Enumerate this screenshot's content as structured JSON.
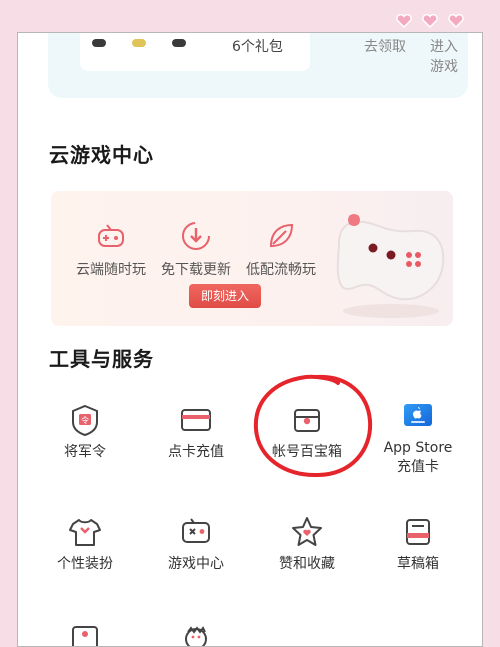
{
  "top": {
    "gift_text": "6个礼包",
    "action_left": "去领取",
    "action_right": "进入游戏"
  },
  "cloud": {
    "title": "云游戏中心",
    "features": [
      {
        "label": "云端随时玩",
        "icon": "gamepad-icon"
      },
      {
        "label": "免下载更新",
        "icon": "download-icon"
      },
      {
        "label": "低配流畅玩",
        "icon": "leaf-icon"
      }
    ],
    "join_label": "即刻进入"
  },
  "tools": {
    "title": "工具与服务",
    "items": [
      {
        "label": "将军令",
        "icon": "shield-token-icon"
      },
      {
        "label": "点卡充值",
        "icon": "card-icon"
      },
      {
        "label": "帐号百宝箱",
        "icon": "treasure-box-icon"
      },
      {
        "label": "App Store\n充值卡",
        "icon": "app-store-icon"
      },
      {
        "label": "个性装扮",
        "icon": "tshirt-icon"
      },
      {
        "label": "游戏中心",
        "icon": "game-console-icon"
      },
      {
        "label": "赞和收藏",
        "icon": "star-like-icon"
      },
      {
        "label": "草稿箱",
        "icon": "draft-box-icon"
      }
    ]
  },
  "colors": {
    "accent": "#e04c47",
    "icon_stroke": "#444444",
    "icon_accent": "#e8616b",
    "annotation": "#e5252b",
    "page_bg": "#f6dde6"
  }
}
